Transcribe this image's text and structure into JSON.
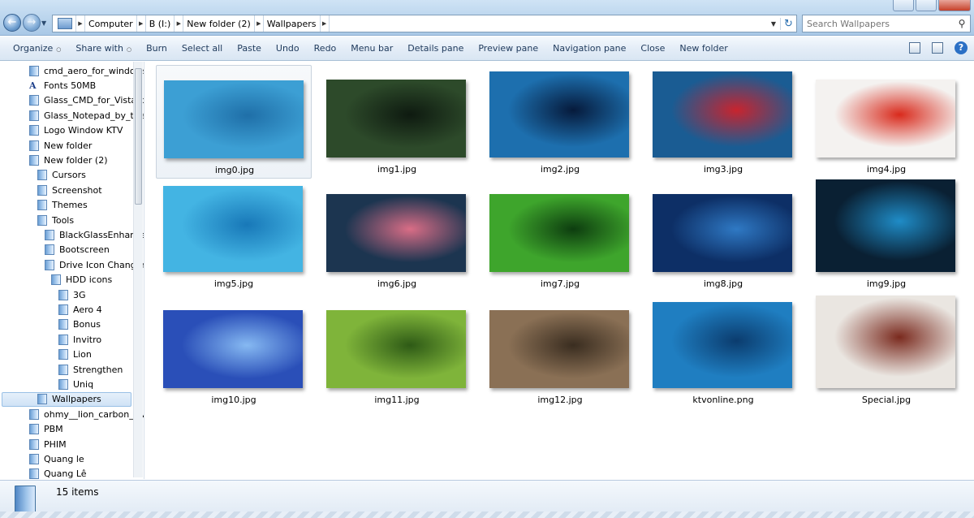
{
  "address": {
    "crumbs": [
      "Computer",
      "B (I:)",
      "New folder (2)",
      "Wallpapers"
    ]
  },
  "search": {
    "placeholder": "Search Wallpapers"
  },
  "toolbar": {
    "items": [
      {
        "label": "Organize",
        "dropdown": true
      },
      {
        "label": "Share with",
        "dropdown": true
      },
      {
        "label": "Burn",
        "dropdown": false
      },
      {
        "label": "Select all",
        "dropdown": false
      },
      {
        "label": "Paste",
        "dropdown": false
      },
      {
        "label": "Undo",
        "dropdown": false
      },
      {
        "label": "Redo",
        "dropdown": false
      },
      {
        "label": "Menu bar",
        "dropdown": false
      },
      {
        "label": "Details pane",
        "dropdown": false
      },
      {
        "label": "Preview pane",
        "dropdown": false
      },
      {
        "label": "Navigation pane",
        "dropdown": false
      },
      {
        "label": "Close",
        "dropdown": false
      },
      {
        "label": "New folder",
        "dropdown": false
      }
    ]
  },
  "tree": [
    {
      "label": "cmd_aero_for_windows_",
      "level": 0
    },
    {
      "label": "Fonts 50MB",
      "level": 0,
      "icon": "font"
    },
    {
      "label": "Glass_CMD_for_Vista_by",
      "level": 0
    },
    {
      "label": "Glass_Notepad_by_thek",
      "level": 0
    },
    {
      "label": "Logo Window KTV",
      "level": 0
    },
    {
      "label": "New folder",
      "level": 0
    },
    {
      "label": "New folder (2)",
      "level": 0
    },
    {
      "label": "Cursors",
      "level": 1
    },
    {
      "label": "Screenshot",
      "level": 1
    },
    {
      "label": "Themes",
      "level": 1
    },
    {
      "label": "Tools",
      "level": 1
    },
    {
      "label": "BlackGlassEnhancec",
      "level": 2
    },
    {
      "label": "Bootscreen",
      "level": 2
    },
    {
      "label": "Drive Icon Changer",
      "level": 2
    },
    {
      "label": "HDD icons",
      "level": 3
    },
    {
      "label": "3G",
      "level": 4
    },
    {
      "label": "Aero 4",
      "level": 4
    },
    {
      "label": "Bonus",
      "level": 4
    },
    {
      "label": "Invitro",
      "level": 4
    },
    {
      "label": "Lion",
      "level": 4
    },
    {
      "label": "Strengthen",
      "level": 4
    },
    {
      "label": "Uniq",
      "level": 4
    },
    {
      "label": "Wallpapers",
      "level": 1,
      "selected": true
    },
    {
      "label": "ohmy__lion_carbon__w",
      "level": 0
    },
    {
      "label": "PBM",
      "level": 0
    },
    {
      "label": "PHIM",
      "level": 0
    },
    {
      "label": "Quang le",
      "level": 0
    },
    {
      "label": "Quang Lê",
      "level": 0
    }
  ],
  "files": [
    {
      "name": "img0.jpg",
      "selected": true,
      "colors": [
        "#3c9fd4",
        "#1f6fa8"
      ]
    },
    {
      "name": "img1.jpg",
      "colors": [
        "#2d4a2a",
        "#0e1a10"
      ]
    },
    {
      "name": "img2.jpg",
      "colors": [
        "#1d6fae",
        "#061a3b"
      ]
    },
    {
      "name": "img3.jpg",
      "colors": [
        "#1a5c93",
        "#c8242e"
      ]
    },
    {
      "name": "img4.jpg",
      "colors": [
        "#f4f2f0",
        "#d92a1c"
      ]
    },
    {
      "name": "img5.jpg",
      "colors": [
        "#43b4e3",
        "#1878b8"
      ]
    },
    {
      "name": "img6.jpg",
      "colors": [
        "#1c3550",
        "#d96d86"
      ]
    },
    {
      "name": "img7.jpg",
      "colors": [
        "#3ea52c",
        "#0d3d0f"
      ]
    },
    {
      "name": "img8.jpg",
      "colors": [
        "#0d2f66",
        "#2f79c4"
      ]
    },
    {
      "name": "img9.jpg",
      "colors": [
        "#0a2033",
        "#1f8cc7"
      ]
    },
    {
      "name": "img10.jpg",
      "colors": [
        "#2a4fb8",
        "#86b9f2"
      ]
    },
    {
      "name": "img11.jpg",
      "colors": [
        "#7fb43a",
        "#2e5a16"
      ]
    },
    {
      "name": "img12.jpg",
      "colors": [
        "#8a7055",
        "#3a2d20"
      ]
    },
    {
      "name": "ktvonline.png",
      "colors": [
        "#1f7ec1",
        "#0b3c6e"
      ]
    },
    {
      "name": "Special.jpg",
      "colors": [
        "#eae6e1",
        "#7a2a1e"
      ]
    }
  ],
  "status": {
    "count": "15 items"
  }
}
